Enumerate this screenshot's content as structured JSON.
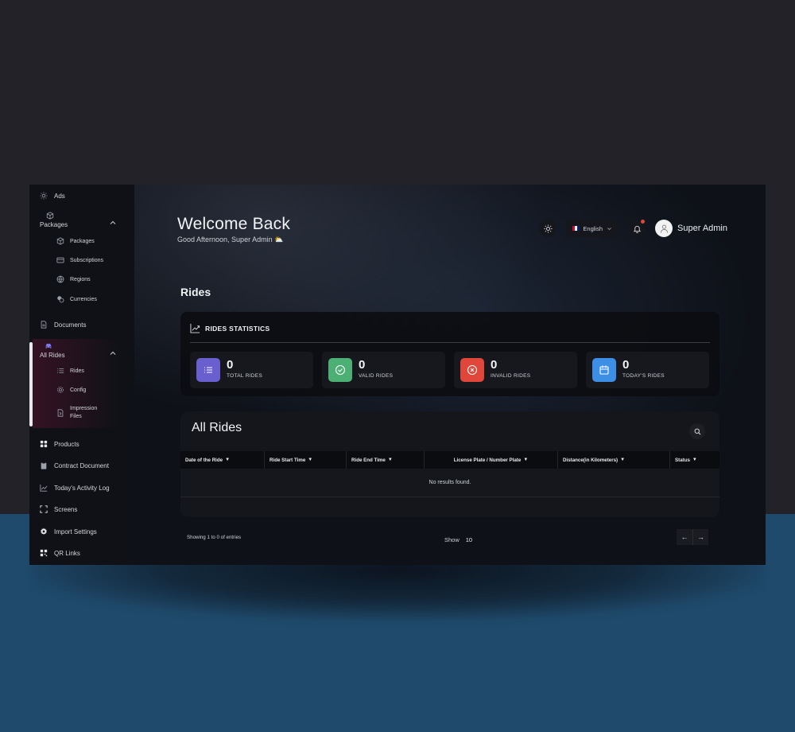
{
  "sidebar": {
    "items": [
      {
        "label": "Ads",
        "icon": "sun-icon"
      },
      {
        "label": "Packages",
        "icon": "box-icon"
      },
      {
        "label": "Packages",
        "icon": "box-icon"
      },
      {
        "label": "Subscriptions",
        "icon": "card-icon"
      },
      {
        "label": "Regions",
        "icon": "globe-icon"
      },
      {
        "label": "Currencies",
        "icon": "coins-icon"
      },
      {
        "label": "Documents",
        "icon": "document-icon"
      },
      {
        "label": "All Rides",
        "icon": "car-icon"
      },
      {
        "label": "Rides",
        "icon": "list-icon"
      },
      {
        "label": "Config",
        "icon": "gear-icon"
      },
      {
        "label": "Impression",
        "label2": "Files",
        "icon": "file-icon"
      },
      {
        "label": "Products",
        "icon": "grid-icon"
      },
      {
        "label": "Contract Document",
        "icon": "clipboard-icon"
      },
      {
        "label": "Today's Activity Log",
        "icon": "chart-line-icon"
      },
      {
        "label": "Screens",
        "icon": "expand-icon"
      },
      {
        "label": "Import Settings",
        "icon": "gear-icon"
      },
      {
        "label": "QR Links",
        "icon": "qr-icon"
      }
    ],
    "active_item": "All Rides"
  },
  "header": {
    "title": "Welcome Back",
    "greeting": "Good Afternoon, Super Admin ⛅",
    "language": "English",
    "user_name": "Super Admin"
  },
  "page": {
    "title": "Rides"
  },
  "stats": {
    "heading": "RIDES STATISTICS",
    "cards": [
      {
        "value": "0",
        "label": "TOTAL RIDES",
        "color": "#6a5fcf",
        "icon": "list-icon"
      },
      {
        "value": "0",
        "label": "VALID RIDES",
        "color": "#4caf73",
        "icon": "check-circle-icon"
      },
      {
        "value": "0",
        "label": "INVALID RIDES",
        "color": "#e0463a",
        "icon": "x-circle-icon"
      },
      {
        "value": "0",
        "label": "TODAY'S RIDES",
        "color": "#3d8fe6",
        "icon": "calendar-icon"
      }
    ]
  },
  "table": {
    "title": "All Rides",
    "columns": [
      "Date of the Ride",
      "Ride Start Time",
      "Ride End Time",
      "License Plate / Number Plate",
      "Distance(in Kilometers)",
      "Status"
    ],
    "empty_text": "No results found.",
    "footer_info": "Showing 1 to 0 of entries",
    "show_label": "Show",
    "show_value": "10",
    "prev": "←",
    "next": "→"
  },
  "colors": {
    "backdrop_top": "#222228",
    "backdrop_bottom": "#1f4a6b",
    "app_bg": "#0d0f14"
  }
}
